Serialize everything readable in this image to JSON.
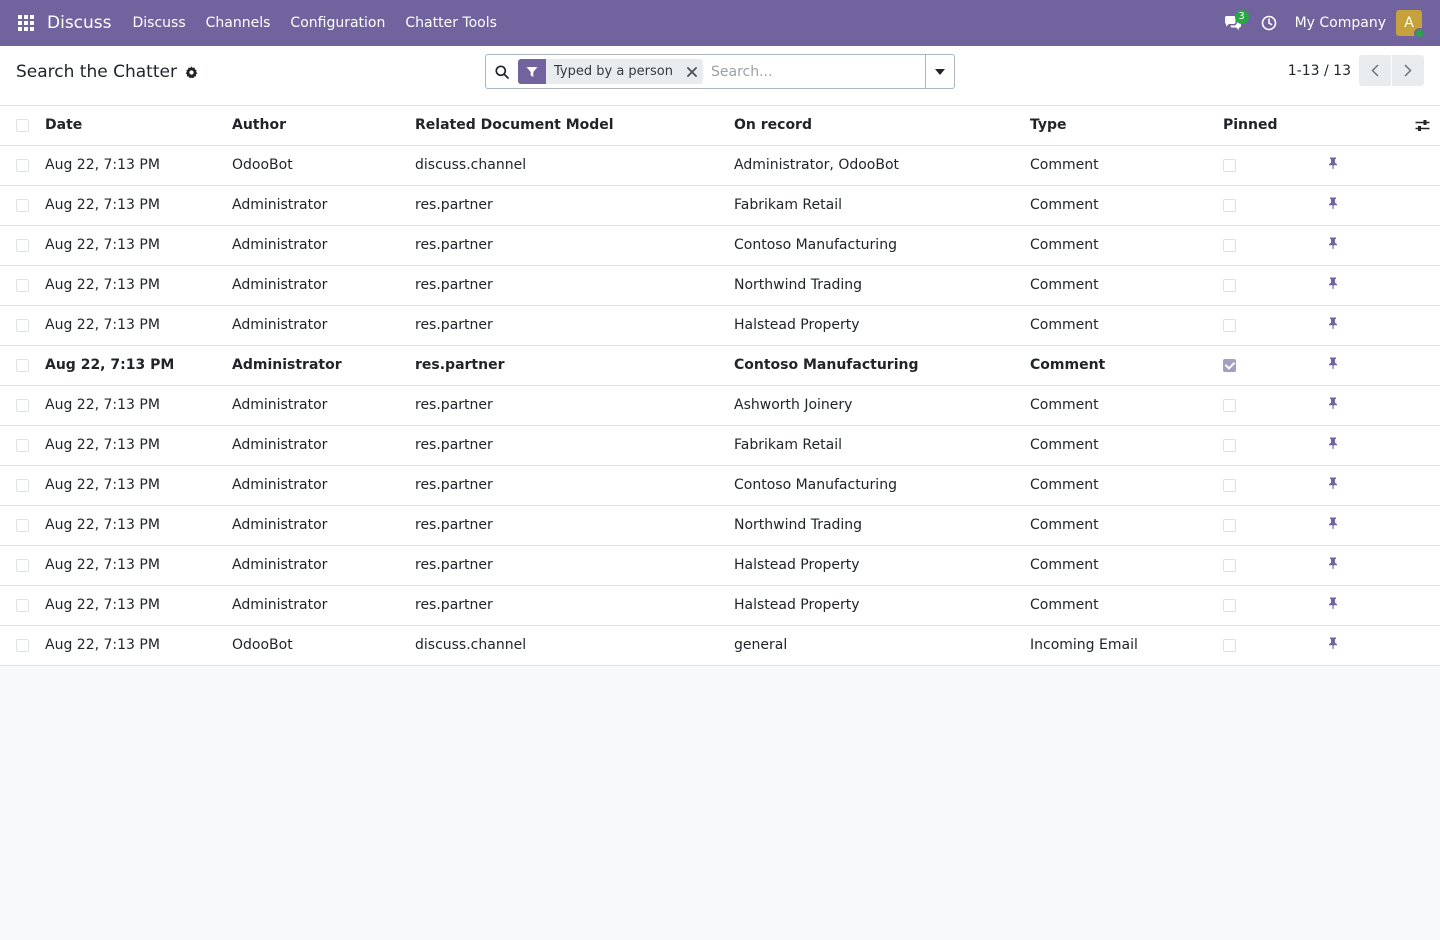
{
  "navbar": {
    "brand": "Discuss",
    "menu": [
      "Discuss",
      "Channels",
      "Configuration",
      "Chatter Tools"
    ],
    "messages_count": "3",
    "company": "My Company",
    "avatar_initial": "A"
  },
  "control_panel": {
    "title": "Search the Chatter",
    "facet_label": "Typed by a person",
    "search_placeholder": "Search...",
    "pager_value": "1-13 / 13"
  },
  "table": {
    "columns": [
      "Date",
      "Author",
      "Related Document Model",
      "On record",
      "Type",
      "Pinned"
    ],
    "rows": [
      {
        "date": "Aug 22, 7:13 PM",
        "author": "OdooBot",
        "model": "discuss.channel",
        "record": "Administrator, OdooBot",
        "type": "Comment",
        "pinned": false
      },
      {
        "date": "Aug 22, 7:13 PM",
        "author": "Administrator",
        "model": "res.partner",
        "record": "Fabrikam Retail",
        "type": "Comment",
        "pinned": false
      },
      {
        "date": "Aug 22, 7:13 PM",
        "author": "Administrator",
        "model": "res.partner",
        "record": "Contoso Manufacturing",
        "type": "Comment",
        "pinned": false
      },
      {
        "date": "Aug 22, 7:13 PM",
        "author": "Administrator",
        "model": "res.partner",
        "record": "Northwind Trading",
        "type": "Comment",
        "pinned": false
      },
      {
        "date": "Aug 22, 7:13 PM",
        "author": "Administrator",
        "model": "res.partner",
        "record": "Halstead Property",
        "type": "Comment",
        "pinned": false
      },
      {
        "date": "Aug 22, 7:13 PM",
        "author": "Administrator",
        "model": "res.partner",
        "record": "Contoso Manufacturing",
        "type": "Comment",
        "pinned": true
      },
      {
        "date": "Aug 22, 7:13 PM",
        "author": "Administrator",
        "model": "res.partner",
        "record": "Ashworth Joinery",
        "type": "Comment",
        "pinned": false
      },
      {
        "date": "Aug 22, 7:13 PM",
        "author": "Administrator",
        "model": "res.partner",
        "record": "Fabrikam Retail",
        "type": "Comment",
        "pinned": false
      },
      {
        "date": "Aug 22, 7:13 PM",
        "author": "Administrator",
        "model": "res.partner",
        "record": "Contoso Manufacturing",
        "type": "Comment",
        "pinned": false
      },
      {
        "date": "Aug 22, 7:13 PM",
        "author": "Administrator",
        "model": "res.partner",
        "record": "Northwind Trading",
        "type": "Comment",
        "pinned": false
      },
      {
        "date": "Aug 22, 7:13 PM",
        "author": "Administrator",
        "model": "res.partner",
        "record": "Halstead Property",
        "type": "Comment",
        "pinned": false
      },
      {
        "date": "Aug 22, 7:13 PM",
        "author": "Administrator",
        "model": "res.partner",
        "record": "Halstead Property",
        "type": "Comment",
        "pinned": false
      },
      {
        "date": "Aug 22, 7:13 PM",
        "author": "OdooBot",
        "model": "discuss.channel",
        "record": "general",
        "type": "Incoming Email",
        "pinned": false
      }
    ]
  },
  "colors": {
    "navbar": "#71639e",
    "badge": "#28a745",
    "avatar": "#c5a23b",
    "pin": "#71639e"
  },
  "icons": [
    "apps-grid-icon",
    "chat-bubbles-icon",
    "clock-icon",
    "gear-icon",
    "search-icon",
    "filter-icon",
    "close-icon",
    "caret-down-icon",
    "chevron-left-icon",
    "chevron-right-icon",
    "sliders-icon",
    "pin-icon"
  ]
}
